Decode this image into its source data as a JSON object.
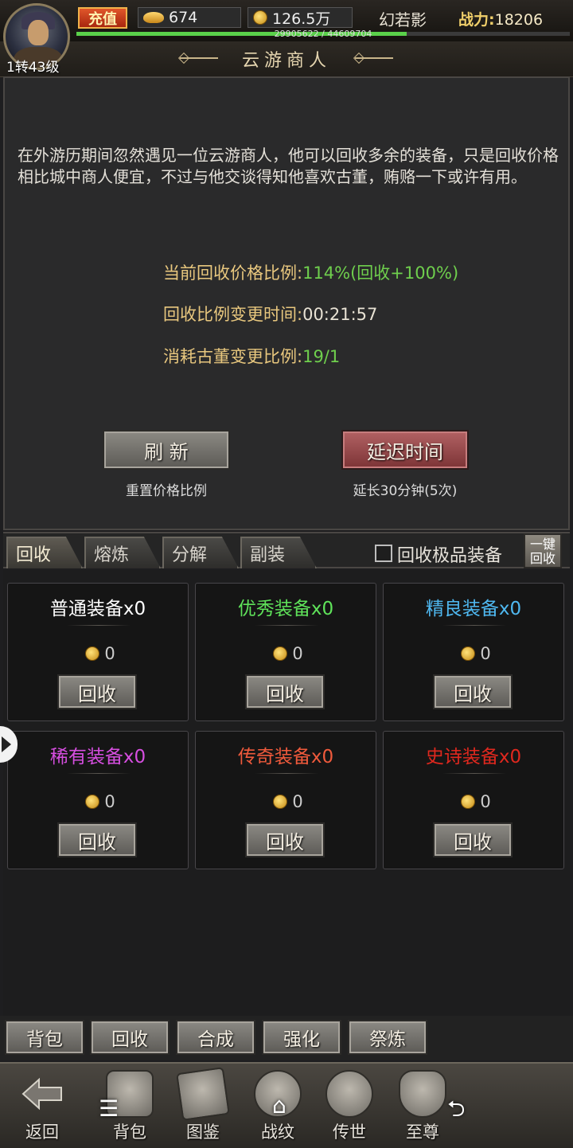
{
  "player": {
    "level": "1转43级",
    "recharge_label": "充值",
    "ingot": "674",
    "gold": "126.5万",
    "name": "幻若影",
    "power_label": "战力:",
    "power_value": "18206",
    "exp_text": "29905622 / 44609704",
    "exp_fraction": 0.67
  },
  "window": {
    "title": "云游商人"
  },
  "merchant": {
    "description": "在外游历期间忽然遇见一位云游商人，他可以回收多余的装备，只是回收价格相比城中商人便宜，不过与他交谈得知他喜欢古董，贿赂一下或许有用。",
    "stats": [
      {
        "label": "当前回收价格比例:",
        "value": "114%(回收+100%)"
      },
      {
        "label": "回收比例变更时间:",
        "value": "00:21:57"
      },
      {
        "label": "消耗古董变更比例:",
        "value": "19/1"
      }
    ],
    "refresh_label": "刷 新",
    "refresh_sub": "重置价格比例",
    "delay_label": "延迟时间",
    "delay_sub": "延长30分钟(5次)"
  },
  "tabs": [
    {
      "label": "回收",
      "active": true
    },
    {
      "label": "熔炼",
      "active": false
    },
    {
      "label": "分解",
      "active": false
    },
    {
      "label": "副装",
      "active": false
    }
  ],
  "recycle_premium_label": "回收极品装备",
  "one_key_label": "一键回收",
  "cards": [
    {
      "name": "普通装备x0",
      "color": "#ffffff",
      "price": "0",
      "button": "回收"
    },
    {
      "name": "优秀装备x0",
      "color": "#5fe35a",
      "price": "0",
      "button": "回收"
    },
    {
      "name": "精良装备x0",
      "color": "#4fb8f0",
      "price": "0",
      "button": "回收"
    },
    {
      "name": "稀有装备x0",
      "color": "#d64ee0",
      "price": "0",
      "button": "回收"
    },
    {
      "name": "传奇装备x0",
      "color": "#f05a3c",
      "price": "0",
      "button": "回收"
    },
    {
      "name": "史诗装备x0",
      "color": "#e0281e",
      "price": "0",
      "button": "回收"
    }
  ],
  "subnav": [
    "背包",
    "回收",
    "合成",
    "强化",
    "祭炼"
  ],
  "mainnav": [
    {
      "label": "返回",
      "icon": "back-arrow-icon"
    },
    {
      "label": "背包",
      "icon": "bag-icon"
    },
    {
      "label": "图鉴",
      "icon": "book-icon"
    },
    {
      "label": "战纹",
      "icon": "emblem-icon"
    },
    {
      "label": "传世",
      "icon": "dragon-icon"
    },
    {
      "label": "至尊",
      "icon": "demon-mask-icon"
    }
  ],
  "system_nav": {
    "menu_icon": "menu-icon",
    "home_icon": "home-icon",
    "back_icon": "back-icon"
  }
}
